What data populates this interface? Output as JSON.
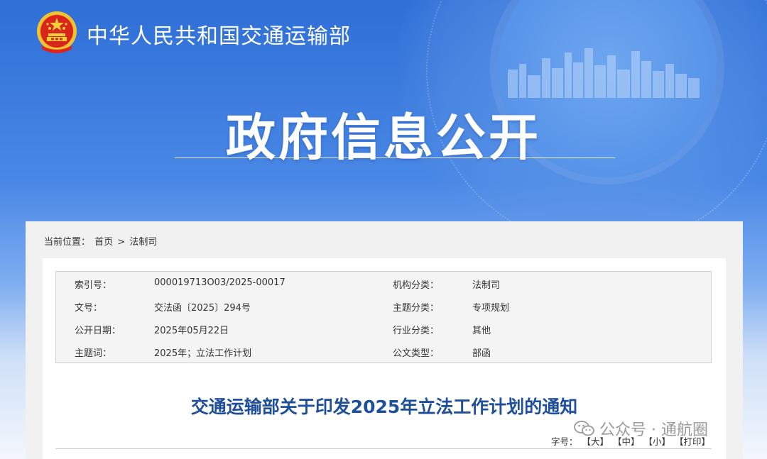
{
  "header": {
    "org_name": "中华人民共和国交通运输部",
    "banner_title": "政府信息公开",
    "logo_icon": "national-emblem-icon"
  },
  "breadcrumb": {
    "prefix": "当前位置：",
    "items": [
      "首页",
      "法制司"
    ],
    "separator": ">"
  },
  "metadata": {
    "rows": [
      {
        "label1": "索引号：",
        "value1": "000019713O03/2025-00017",
        "label2": "机构分类：",
        "value2": "法制司"
      },
      {
        "label1": "文号：",
        "value1": "交法函〔2025〕294号",
        "label2": "主题分类：",
        "value2": "专项规划"
      },
      {
        "label1": "公开日期：",
        "value1": "2025年05月22日",
        "label2": "行业分类：",
        "value2": "其他"
      },
      {
        "label1": "主题词：",
        "value1": "2025年；立法工作计划",
        "label2": "公文类型：",
        "value2": "部函"
      }
    ]
  },
  "document": {
    "title": "交通运输部关于印发2025年立法工作计划的通知"
  },
  "font_size": {
    "label": "字号：",
    "large": "【大】",
    "medium": "【中】",
    "small": "【小】",
    "print": "【打印】"
  },
  "watermark": {
    "text": "公众号 · 通航圈",
    "icon": "wechat-icon"
  },
  "colors": {
    "banner_blue": "#2f6fd6",
    "title_blue": "#1e4f9a"
  }
}
